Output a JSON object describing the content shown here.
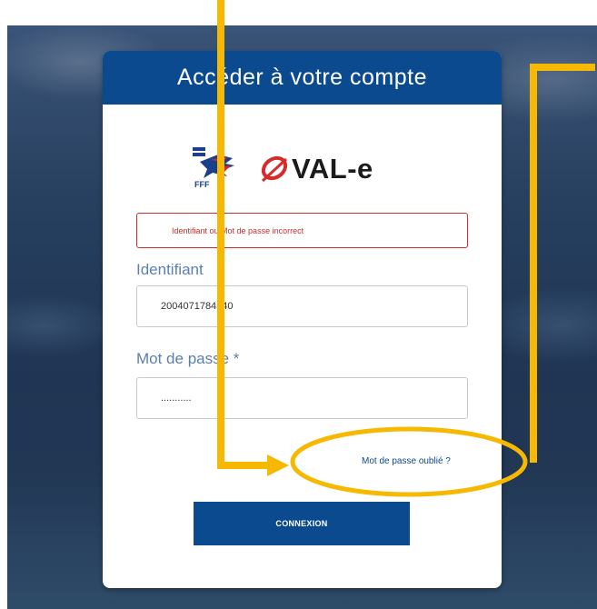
{
  "header": {
    "title": "Accéder à votre compte"
  },
  "logos": {
    "fff_text": "FFF",
    "oval_text": "VAL-e"
  },
  "error": {
    "message": "Identifiant ou Mot de passe incorrect"
  },
  "form": {
    "identifiant_label": "Identifiant",
    "identifiant_value": "2004071784540",
    "password_label": "Mot de passe *",
    "password_value": "...........",
    "forgot_label": "Mot de passe oublié ?",
    "submit_label": "CONNEXION"
  },
  "colors": {
    "brand_blue": "#0b4a8f",
    "error_red": "#c9302c",
    "label_blue": "#5a7fb0",
    "annotation_yellow": "#f6b800",
    "oval_red": "#d52b2b"
  },
  "icons": {
    "fff_logo": "fff-rooster-logo-icon",
    "oval_mark": "oval-mark-icon"
  }
}
